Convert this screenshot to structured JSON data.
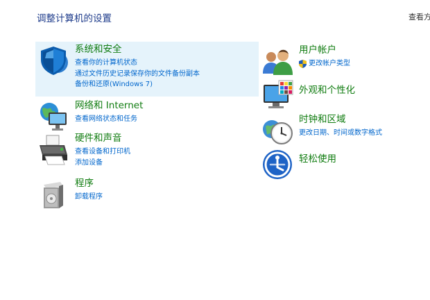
{
  "header": {
    "title": "调整计算机的设置",
    "view_by": "查看方"
  },
  "left_column": [
    {
      "title": "系统和安全",
      "icon": "security-shield-icon",
      "links": [
        "查看你的计算机状态",
        "通过文件历史记录保存你的文件备份副本",
        "备份和还原(Windows 7)"
      ]
    },
    {
      "title": "网络和 Internet",
      "icon": "network-globe-icon",
      "links": [
        "查看网络状态和任务"
      ]
    },
    {
      "title": "硬件和声音",
      "icon": "printer-icon",
      "links": [
        "查看设备和打印机",
        "添加设备"
      ]
    },
    {
      "title": "程序",
      "icon": "programs-box-icon",
      "links": [
        "卸载程序"
      ]
    }
  ],
  "right_column": [
    {
      "title": "用户帐户",
      "icon": "users-icon",
      "links": [
        "更改帐户类型"
      ]
    },
    {
      "title": "外观和个性化",
      "icon": "monitor-palette-icon",
      "links": []
    },
    {
      "title": "时钟和区域",
      "icon": "clock-globe-icon",
      "links": [
        "更改日期、时间或数字格式"
      ]
    },
    {
      "title": "轻松使用",
      "icon": "ease-of-access-icon",
      "links": []
    }
  ],
  "colors": {
    "title_green": "#107c10",
    "link_blue": "#0066cc",
    "header_blue": "#1c3a8a",
    "hover_bg": "#e5f3fb"
  }
}
